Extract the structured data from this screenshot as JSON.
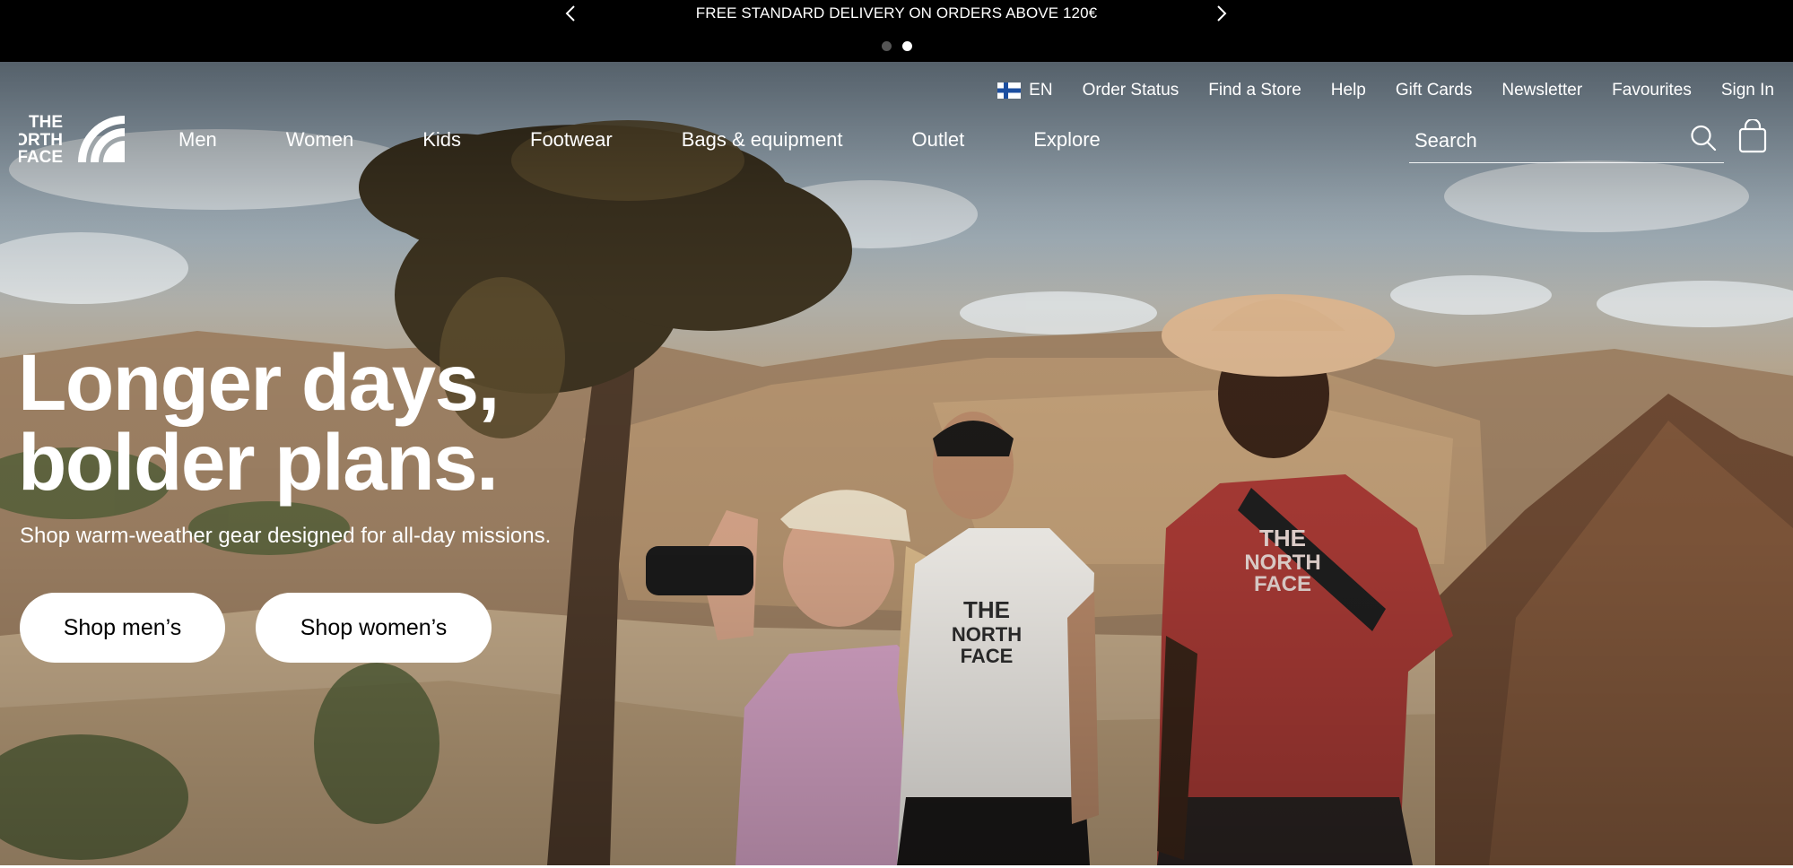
{
  "promo": {
    "message": "FREE STANDARD DELIVERY ON ORDERS ABOVE 120€",
    "prev_icon": "chevron-left-icon",
    "next_icon": "chevron-right-icon",
    "slide_count": 2,
    "active_slide": 2
  },
  "utility_nav": {
    "language": {
      "flag": "finland-flag-icon",
      "code": "EN"
    },
    "links": [
      "Order Status",
      "Find a Store",
      "Help",
      "Gift Cards",
      "Newsletter",
      "Favourites",
      "Sign In"
    ]
  },
  "header": {
    "logo": {
      "line1": "THE",
      "line2": "NORTH",
      "line3": "FACE"
    },
    "nav": [
      "Men",
      "Women",
      "Kids",
      "Footwear",
      "Bags & equipment",
      "Outlet",
      "Explore"
    ],
    "search": {
      "placeholder": "Search",
      "icon": "search-icon"
    },
    "cart_icon": "shopping-bag-icon"
  },
  "hero": {
    "headline_line1": "Longer days,",
    "headline_line2": "bolder plans.",
    "subline": "Shop warm-weather gear designed for all-day missions.",
    "buttons": {
      "men": "Shop men’s",
      "women": "Shop women’s"
    }
  },
  "colors": {
    "promo_bg": "#000000",
    "text_on_hero": "#ffffff",
    "cta_bg": "#ffffff",
    "cta_text": "#000000",
    "shirt_red": "#a83a35",
    "shirt_pink": "#d9a6c9",
    "shirt_white": "#f2efea"
  }
}
